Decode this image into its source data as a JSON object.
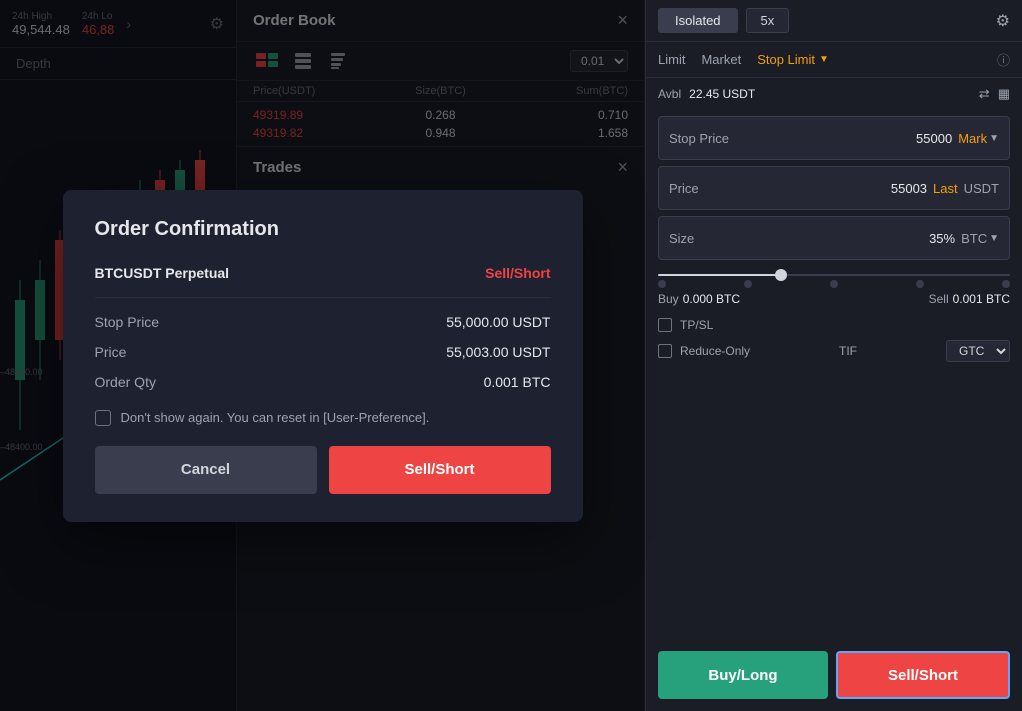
{
  "left_panel": {
    "stats": {
      "high_label": "24h High",
      "high_value": "49,544.48",
      "low_label": "24h Lo",
      "low_value": "46,88"
    },
    "depth_tab": "Depth",
    "price_lines": [
      "48600.00",
      "48400.00"
    ]
  },
  "orderbook": {
    "title": "Order Book",
    "close_btn": "×",
    "size_option": "0.01",
    "columns": [
      "Price(USDT)",
      "Size(BTC)",
      "Sum(BTC)"
    ],
    "rows_sell": [
      {
        "price": "49319.89",
        "size": "0.268",
        "sum": "0.710"
      },
      {
        "price": "49319.82",
        "size": "0.948",
        "sum": "1.658"
      }
    ],
    "trades_title": "Trades",
    "trades_close": "×"
  },
  "right_panel": {
    "mode_isolated": "Isolated",
    "mode_leverage": "5x",
    "settings_icon": "⚙",
    "order_types": {
      "limit": "Limit",
      "market": "Market",
      "stop_limit": "Stop Limit",
      "dropdown_arrow": "▼"
    },
    "info_icon": "ⓘ",
    "avbl_label": "Avbl",
    "avbl_value": "22.45 USDT",
    "transfer_icon": "⇄",
    "calc_icon": "▦",
    "stop_price_label": "Stop Price",
    "stop_price_value": "55000",
    "stop_price_type": "Mark",
    "stop_price_dropdown": "▼",
    "price_label": "Price",
    "price_value": "55003",
    "price_type": "Last",
    "price_currency": "USDT",
    "size_label": "Size",
    "size_percent": "35%",
    "size_currency": "BTC",
    "size_dropdown": "▼",
    "buy_label": "Buy",
    "buy_value": "0.000 BTC",
    "sell_label": "Sell",
    "sell_value": "0.001 BTC",
    "tpsl_label": "TP/SL",
    "reduce_only_label": "Reduce-Only",
    "tif_label": "TIF",
    "tif_value": "GTC",
    "buy_btn": "Buy/Long",
    "sell_btn": "Sell/Short"
  },
  "modal": {
    "title": "Order Confirmation",
    "pair": "BTCUSDT Perpetual",
    "side": "Sell/Short",
    "stop_price_label": "Stop Price",
    "stop_price_value": "55,000.00 USDT",
    "price_label": "Price",
    "price_value": "55,003.00 USDT",
    "qty_label": "Order Qty",
    "qty_value": "0.001 BTC",
    "checkbox_text": "Don't show again. You can reset in [User-Preference].",
    "cancel_btn": "Cancel",
    "sell_btn": "Sell/Short"
  }
}
